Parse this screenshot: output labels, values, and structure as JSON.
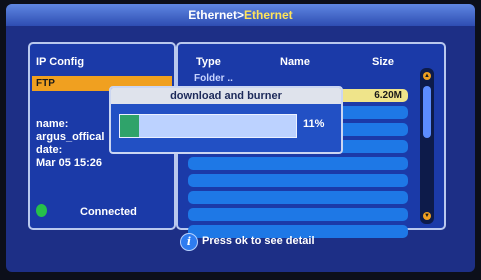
{
  "titlebar": {
    "parent": "Ethernet",
    "separator": ">",
    "current": "Ethernet"
  },
  "left_panel": {
    "header": "IP Config",
    "ftp_label": "FTP",
    "name_label": "name:",
    "name_value": "argus_offical",
    "date_label": "date:",
    "date_value": "Mar 05 15:26",
    "status": "Connected",
    "status_color": "#26c04a"
  },
  "file_list": {
    "columns": {
      "type": "Type",
      "name": "Name",
      "size": "Size"
    },
    "rows": [
      {
        "type": "Folder ..",
        "size": ""
      },
      {
        "type": "",
        "size": "6.20M"
      },
      {
        "type": "",
        "size": ""
      },
      {
        "type": "",
        "size": ""
      },
      {
        "type": "",
        "size": ""
      },
      {
        "type": "",
        "size": ""
      },
      {
        "type": "",
        "size": ""
      },
      {
        "type": "",
        "size": ""
      },
      {
        "type": "",
        "size": ""
      },
      {
        "type": "",
        "size": ""
      }
    ]
  },
  "dialog": {
    "title": "download and burner",
    "progress_percent": 11,
    "progress_text": "11%"
  },
  "footer": {
    "hint": "Press ok to see detail"
  },
  "colors": {
    "panel_bg": "#1b3aa8",
    "highlight": "#f0a020",
    "row_bg": "#1e78e6",
    "selected_row": "#efe48a"
  }
}
